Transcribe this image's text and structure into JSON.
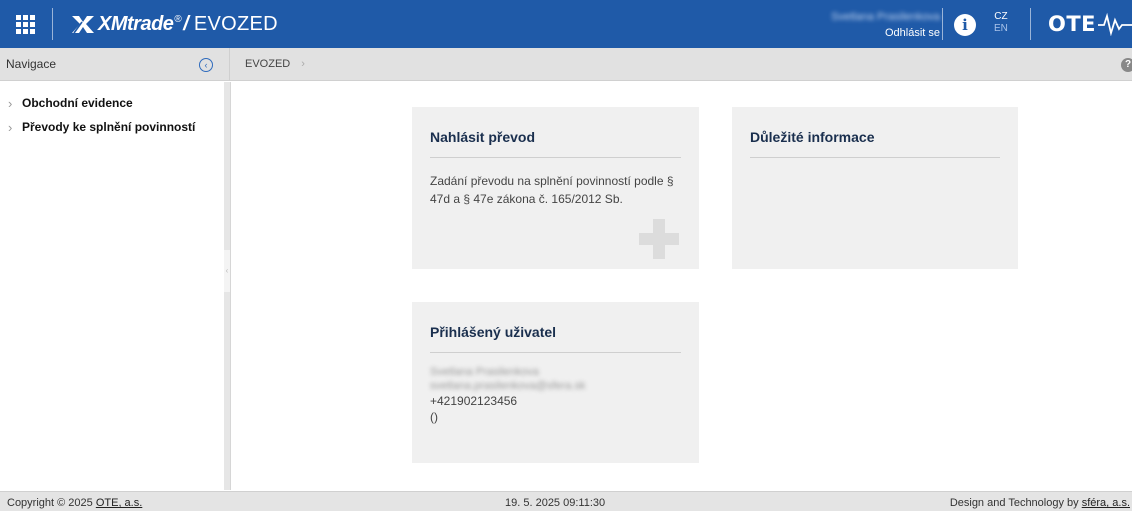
{
  "topbar": {
    "apps_icon": "app-grid-icon",
    "brand_name": "XMtrade",
    "brand_reg": "®",
    "brand_slash": "/",
    "module": "EVOZED",
    "user_name": "Svetlana Prasilenkova",
    "logout": "Odhlásit se",
    "info_glyph": "i",
    "languages": [
      "CZ",
      "EN"
    ],
    "ote_logo": "OTE",
    "colors": {
      "bar": "#1f5aa8",
      "text": "#ffffff"
    }
  },
  "nav": {
    "title": "Navigace",
    "collapse_glyph": "‹",
    "items": [
      {
        "label": "Obchodní evidence"
      },
      {
        "label": "Převody ke splnění povinností"
      }
    ]
  },
  "breadcrumb": {
    "current": "EVOZED",
    "chevron": "›"
  },
  "help_glyph": "?",
  "cards": {
    "report": {
      "title": "Nahlásit převod",
      "text": "Zadání převodu na splnění povinností podle § 47d a § 47e zákona č. 165/2012 Sb."
    },
    "info": {
      "title": "Důležité informace"
    },
    "user": {
      "title": "Přihlášený uživatel",
      "name": "Svetlana Prasilenkova",
      "email": "svetlana.prasilenkova@sfera.sk",
      "phone": "+421902123456",
      "extra": "()"
    }
  },
  "footer": {
    "copyright_prefix": "Copyright © 2025 ",
    "company": "OTE, a.s.",
    "datetime": "19. 5. 2025 09:11:30",
    "design_prefix": "Design and Technology by ",
    "design_company": "sféra, a.s."
  }
}
